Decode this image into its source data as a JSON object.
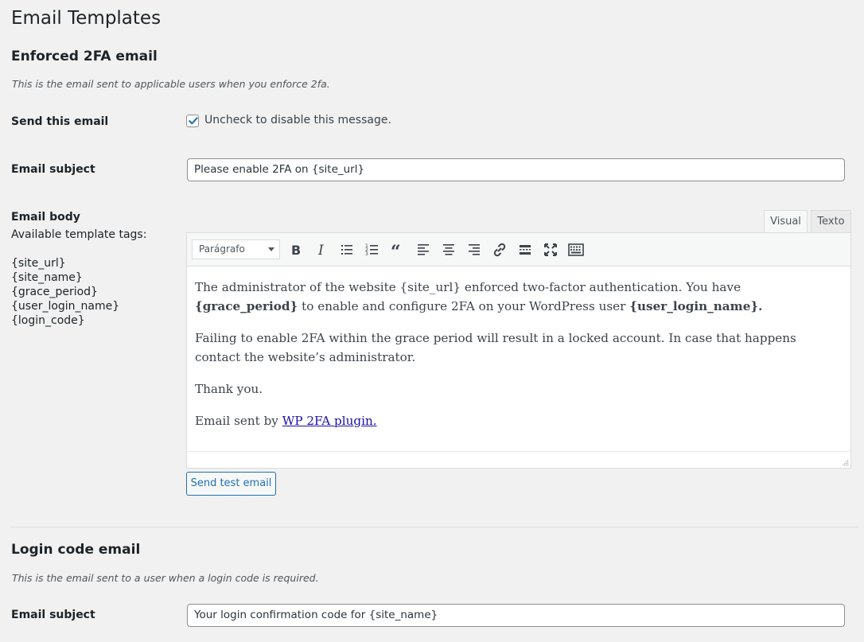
{
  "page": {
    "title": "Email Templates"
  },
  "enforced": {
    "heading": "Enforced 2FA email",
    "description": "This is the email sent to applicable users when you enforce 2fa.",
    "send_label": "Send this email",
    "send_checked": true,
    "send_checkbox_label": "Uncheck to disable this message.",
    "subject_label": "Email subject",
    "subject_value": "Please enable 2FA on {site_url}",
    "body_label": "Email body",
    "tags_intro": "Available template tags:",
    "tags": [
      "{site_url}",
      "{site_name}",
      "{grace_period}",
      "{user_login_name}",
      "{login_code}"
    ],
    "editor": {
      "tabs": [
        "Visual",
        "Texto"
      ],
      "active_tab": "Visual",
      "format_select": "Parágrafo",
      "toolbar_icons": [
        "bold-icon",
        "italic-icon",
        "bullet-list-icon",
        "numbered-list-icon",
        "blockquote-icon",
        "align-left-icon",
        "align-center-icon",
        "align-right-icon",
        "link-icon",
        "read-more-icon",
        "fullscreen-icon",
        "toolbar-toggle-icon"
      ],
      "p1_a": "The administrator of the website {site_url} enforced two-factor authentication. You have ",
      "p1_b": "{grace_period}",
      "p1_c": " to enable and configure 2FA on your WordPress user ",
      "p1_d": "{user_login_name}.",
      "p2": "Failing to enable 2FA within the grace period will result in a locked account. In case that happens contact the website’s administrator.",
      "p3": "Thank you.",
      "p4_a": "Email sent by ",
      "p4_link": "WP 2FA plugin."
    },
    "test_button": "Send test email"
  },
  "login_code": {
    "heading": "Login code email",
    "description": "This is the email sent to a user when a login code is required.",
    "subject_label": "Email subject",
    "subject_value": "Your login confirmation code for {site_name}"
  },
  "colors": {
    "accent": "#2271b1",
    "checkbox_check": "#2271b1",
    "link": "#1a0dab"
  }
}
